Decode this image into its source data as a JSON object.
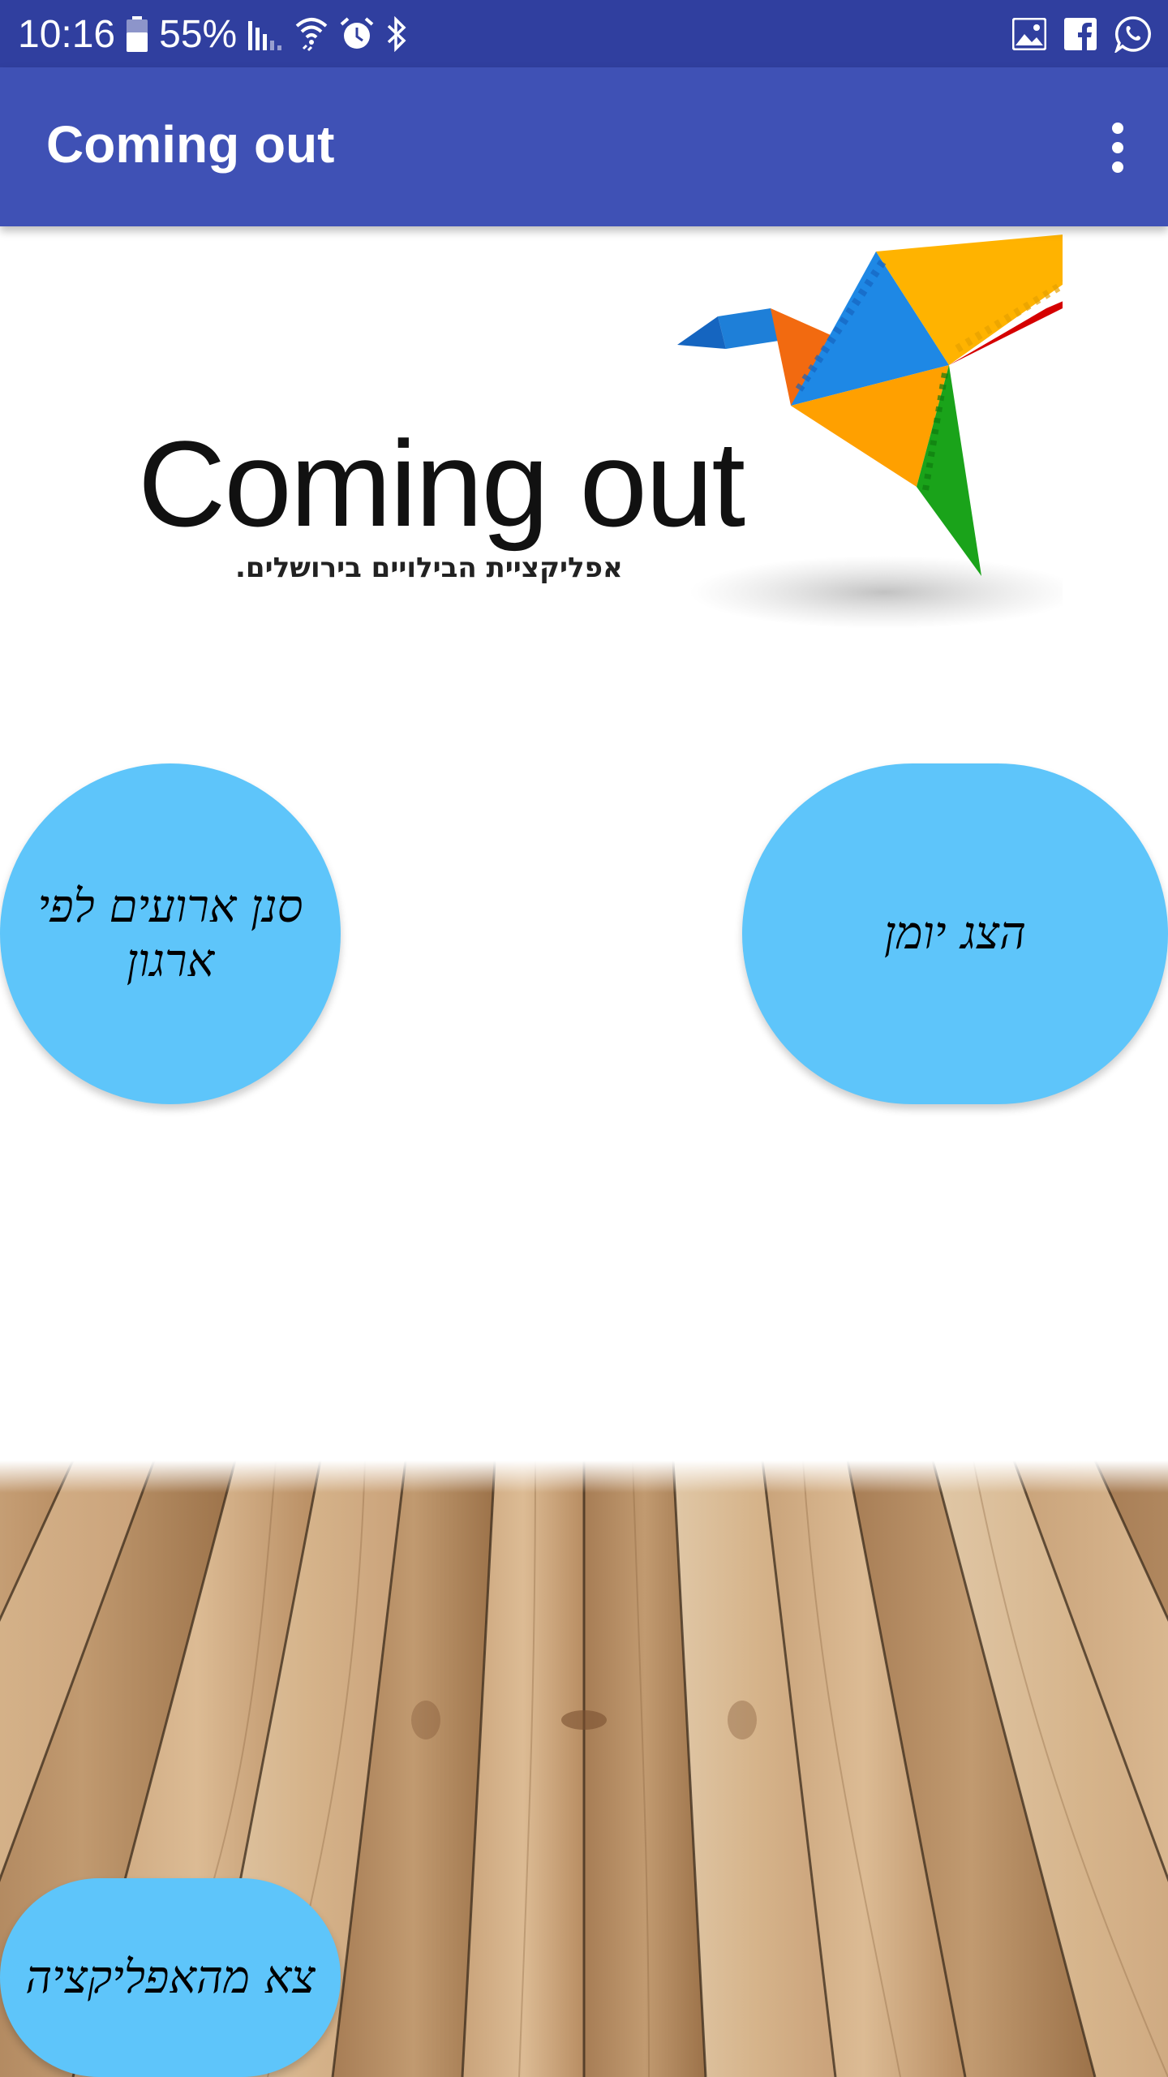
{
  "status_bar": {
    "time": "10:16",
    "battery": "55%",
    "icons": [
      "battery-icon",
      "signal-icon",
      "wifi-icon",
      "alarm-icon",
      "bluetooth-icon",
      "gallery-icon",
      "facebook-icon",
      "whatsapp-icon"
    ]
  },
  "app_bar": {
    "title": "Coming out",
    "menu_icon": "more-vert-icon"
  },
  "logo": {
    "text": "Coming out",
    "tagline": "אפליקציית הבילויים בירושלים."
  },
  "buttons": {
    "by_organization": "סנן ארועים לפי ארגון",
    "show_calendar": "הצג יומן",
    "exit_app": "צא מהאפליקציה"
  },
  "colors": {
    "status_bar": "#303f9f",
    "app_bar": "#3f51b5",
    "button": "#5ec5fa"
  }
}
